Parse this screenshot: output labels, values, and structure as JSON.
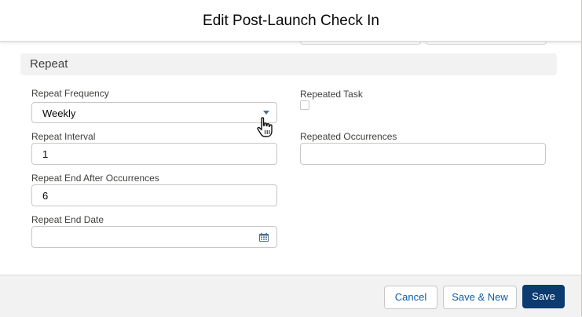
{
  "modal": {
    "title": "Edit Post-Launch Check In"
  },
  "section": {
    "title": "Repeat"
  },
  "fields": {
    "repeat_frequency": {
      "label": "Repeat Frequency",
      "value": "Weekly"
    },
    "repeated_task": {
      "label": "Repeated Task",
      "checked": false
    },
    "repeat_interval": {
      "label": "Repeat Interval",
      "value": "1"
    },
    "repeated_occurrences": {
      "label": "Repeated Occurrences",
      "value": ""
    },
    "repeat_end_after_occurrences": {
      "label": "Repeat End After Occurrences",
      "value": "6"
    },
    "repeat_end_date": {
      "label": "Repeat End Date",
      "value": ""
    }
  },
  "footer": {
    "cancel_label": "Cancel",
    "save_new_label": "Save & New",
    "save_label": "Save"
  },
  "icons": {
    "dropdown": "chevron-down-icon",
    "calendar": "calendar-icon",
    "cursor": "hand-pointer-icon"
  },
  "colors": {
    "brand": "#0b3b6f",
    "link": "#0b5cab",
    "section_bg": "#f3f2f2"
  }
}
